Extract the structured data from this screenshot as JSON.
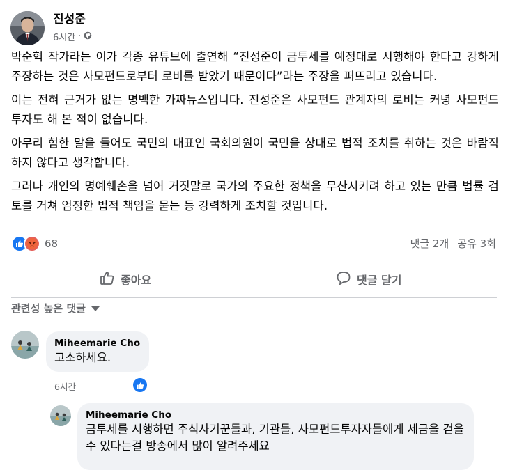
{
  "post": {
    "author": "진성준",
    "time": "6시간",
    "privacy_icon": "globe-icon",
    "paragraphs": [
      "박순혁 작가라는 이가 각종 유튜브에 출연해 “진성준이 금투세를 예정대로 시행해야 한다고 강하게 주장하는 것은 사모펀드로부터 로비를 받았기 때문이다”라는 주장을 퍼뜨리고 있습니다.",
      "이는 전혀 근거가 없는 명백한 가짜뉴스입니다. 진성준은 사모펀드 관계자의 로비는 커녕 사모펀드 투자도 해 본 적이 없습니다.",
      "아무리 험한 말을 들어도 국민의 대표인 국회의원이 국민을 상대로 법적 조치를 취하는 것은 바람직하지 않다고 생각합니다.",
      "그러나 개인의 명예훼손을 넘어 거짓말로 국가의 주요한 정책을 무산시키려 하고 있는 만큼 법률 검토를 거쳐 엄정한 법적 책임을 묻는 등 강력하게 조치할 것입니다."
    ],
    "reactions": {
      "types": [
        "like",
        "angry"
      ],
      "count": "68"
    },
    "comment_count": "댓글 2개",
    "share_count": "공유 3회"
  },
  "actions": {
    "like_label": "좋아요",
    "comment_label": "댓글 달기"
  },
  "comments_sort": {
    "label": "관련성 높은 댓글"
  },
  "comments": [
    {
      "author": "Miheemarie Cho",
      "text": "고소하세요.",
      "time": "6시간"
    },
    {
      "author": "Miheemarie Cho",
      "text": "금투세를 시행하면 주식사기꾼들과, 기관들, 사모펀드투자자들에게 세금을 걷을수 있다는걸 방송에서 많이 알려주세요"
    }
  ],
  "colors": {
    "accent": "#1877f2",
    "secondary_text": "#65676b",
    "bubble": "#f0f2f5"
  }
}
